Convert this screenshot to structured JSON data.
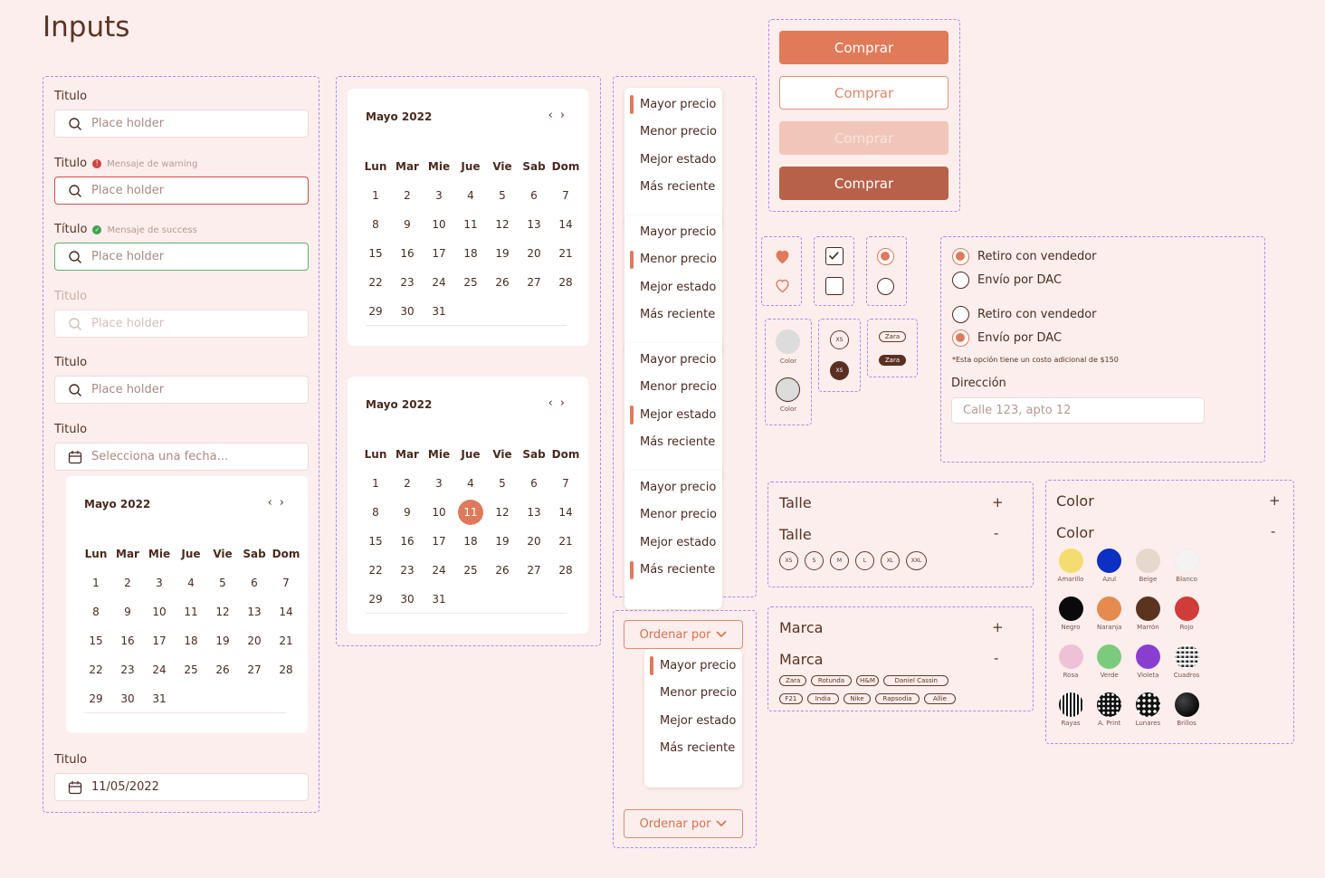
{
  "page_title": "Inputs",
  "form": {
    "f1": {
      "label": "Titulo",
      "placeholder": "Place holder"
    },
    "f2": {
      "label": "Titulo",
      "message": "Mensaje de warning",
      "placeholder": "Place holder"
    },
    "f3": {
      "label": "Título",
      "message": "Mensaje de success",
      "placeholder": "Place holder"
    },
    "f4": {
      "label": "Titulo",
      "placeholder": "Place holder"
    },
    "f5": {
      "label": "Titulo",
      "placeholder": "Place holder"
    },
    "f6": {
      "label": "Titulo",
      "placeholder": "Selecciona una fecha..."
    },
    "f7": {
      "label": "Titulo",
      "value": "11/05/2022"
    }
  },
  "calendar": {
    "month": "Mayo 2022",
    "prev": "‹",
    "next": "›",
    "days": [
      "Lun",
      "Mar",
      "Mie",
      "Jue",
      "Vie",
      "Sab",
      "Dom"
    ],
    "dates": [
      "1",
      "2",
      "3",
      "4",
      "5",
      "6",
      "7",
      "8",
      "9",
      "10",
      "11",
      "12",
      "13",
      "14",
      "15",
      "16",
      "17",
      "18",
      "19",
      "20",
      "21",
      "22",
      "23",
      "24",
      "25",
      "26",
      "27",
      "28",
      "29",
      "30",
      "31"
    ],
    "selected": "11"
  },
  "sort": {
    "options": [
      "Mayor precio",
      "Menor precio",
      "Mejor estado",
      "Más reciente"
    ],
    "button_label": "Ordenar por"
  },
  "buttons": {
    "comprar": "Comprar"
  },
  "controls": {
    "color_label": "Color",
    "size_label": "XS",
    "brand_label": "Zara"
  },
  "shipping": {
    "option1": "Retiro con vendedor",
    "option2": "Envío por DAC",
    "note": "*Esta opción tiene un costo adicional de $150",
    "address_label": "Dirección",
    "address_placeholder": "Calle 123, apto 12"
  },
  "filters": {
    "talle": "Talle",
    "marca": "Marca",
    "color": "Color",
    "plus": "+",
    "minus": "-",
    "sizes": [
      "XS",
      "S",
      "M",
      "L",
      "XL",
      "XXL"
    ],
    "brands_row1": [
      "Zara",
      "Rotunda",
      "H&M",
      "Daniel Cassin"
    ],
    "brands_row2": [
      "F21",
      "India",
      "Nike",
      "Rapsodia",
      "Allie"
    ],
    "colors": [
      {
        "name": "Amarillo",
        "hex": "#f4dc6e"
      },
      {
        "name": "Azul",
        "hex": "#0c2fc4"
      },
      {
        "name": "Beige",
        "hex": "#e6d8cc"
      },
      {
        "name": "Blanco",
        "hex": "#f5f3f1"
      },
      {
        "name": "Negro",
        "hex": "#0a0a0a"
      },
      {
        "name": "Naranja",
        "hex": "#e48c4f"
      },
      {
        "name": "Marrón",
        "hex": "#5b3420"
      },
      {
        "name": "Rojo",
        "hex": "#cf3c3a"
      },
      {
        "name": "Rosa",
        "hex": "#efc1d6"
      },
      {
        "name": "Verde",
        "hex": "#7acb7e"
      },
      {
        "name": "Violeta",
        "hex": "#8a3ed0"
      },
      {
        "name": "Cuadros",
        "hex": "#222222"
      },
      {
        "name": "Rayas",
        "hex": "#111111"
      },
      {
        "name": "A. Print",
        "hex": "#111111"
      },
      {
        "name": "Lunares",
        "hex": "#111111"
      },
      {
        "name": "Brillos",
        "hex": "#151515"
      }
    ]
  },
  "colors": {
    "accent": "#de7a5b",
    "accent_dark": "#b8614a",
    "accent_light": "#f0c4b6",
    "border_dashed": "#a98bf0"
  }
}
